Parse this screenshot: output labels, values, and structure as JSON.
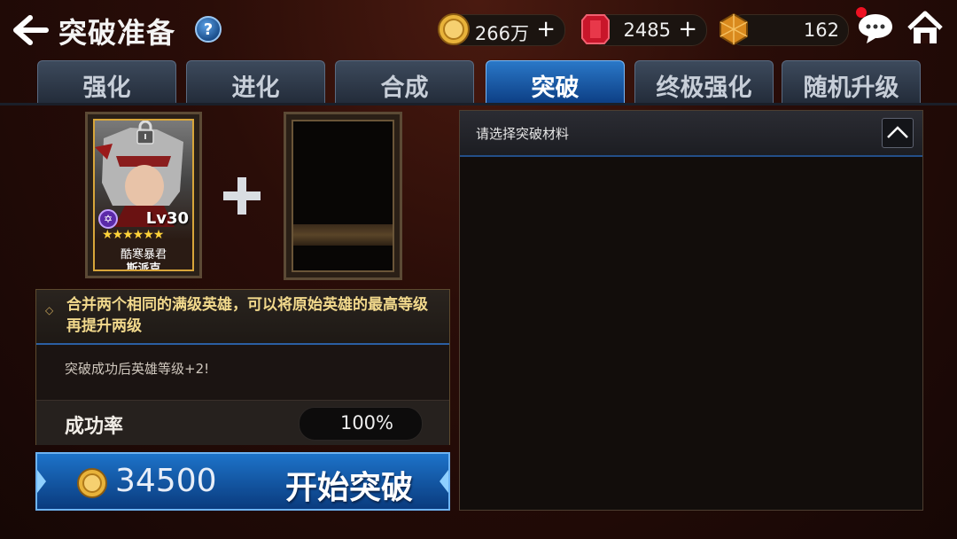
{
  "header": {
    "title": "突破准备",
    "help_label": "?"
  },
  "resources": {
    "gold": "266万",
    "gems": "2485",
    "crystals": "162",
    "plus": "+"
  },
  "tabs": [
    {
      "label": "强化",
      "active": false
    },
    {
      "label": "进化",
      "active": false
    },
    {
      "label": "合成",
      "active": false
    },
    {
      "label": "突破",
      "active": true
    },
    {
      "label": "终极强化",
      "active": false
    },
    {
      "label": "随机升级",
      "active": false
    }
  ],
  "hero_card": {
    "level": "Lv30",
    "stars": "★★★★★★",
    "title": "酷寒暴君",
    "name": "斯派克",
    "element_glyph": "✡"
  },
  "info": {
    "description": "合并两个相同的满级英雄，可以将原始英雄的最高等级再提升两级",
    "bonus": "突破成功后英雄等级+2!",
    "rate_label": "成功率",
    "rate_value": "100%"
  },
  "start_button": {
    "cost": "34500",
    "label": "开始突破"
  },
  "material_panel": {
    "header": "请选择突破材料"
  },
  "colors": {
    "accent_blue": "#1d73c9",
    "gold": "#f2d98c",
    "notification": "#e12"
  }
}
